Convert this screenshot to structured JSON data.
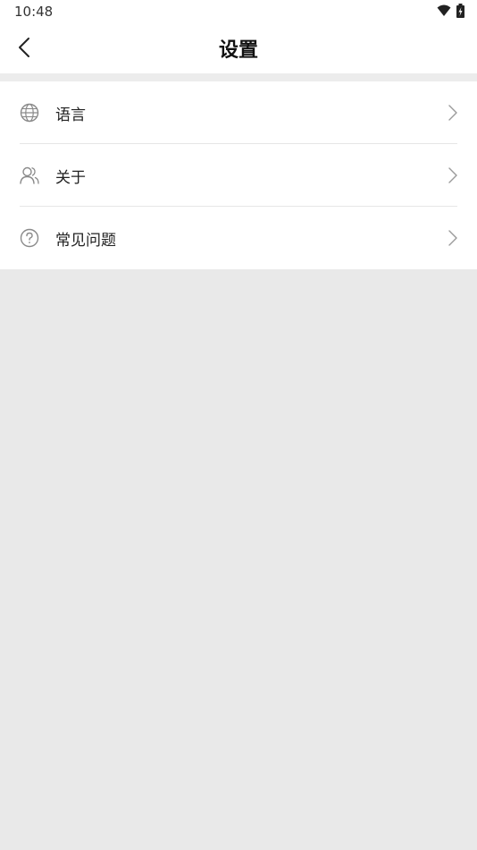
{
  "status_bar": {
    "time": "10:48",
    "wifi_icon": "wifi-icon",
    "battery_icon": "battery-charging-icon"
  },
  "header": {
    "title": "设置",
    "back_icon": "chevron-left-icon"
  },
  "settings": {
    "items": [
      {
        "label": "语言",
        "icon": "globe-icon"
      },
      {
        "label": "关于",
        "icon": "users-icon"
      },
      {
        "label": "常见问题",
        "icon": "question-circle-icon"
      }
    ]
  },
  "colors": {
    "background": "#e9e9e9",
    "surface": "#ffffff",
    "divider": "#e6e6e6",
    "icon": "#8a8a8a",
    "text": "#222222"
  }
}
